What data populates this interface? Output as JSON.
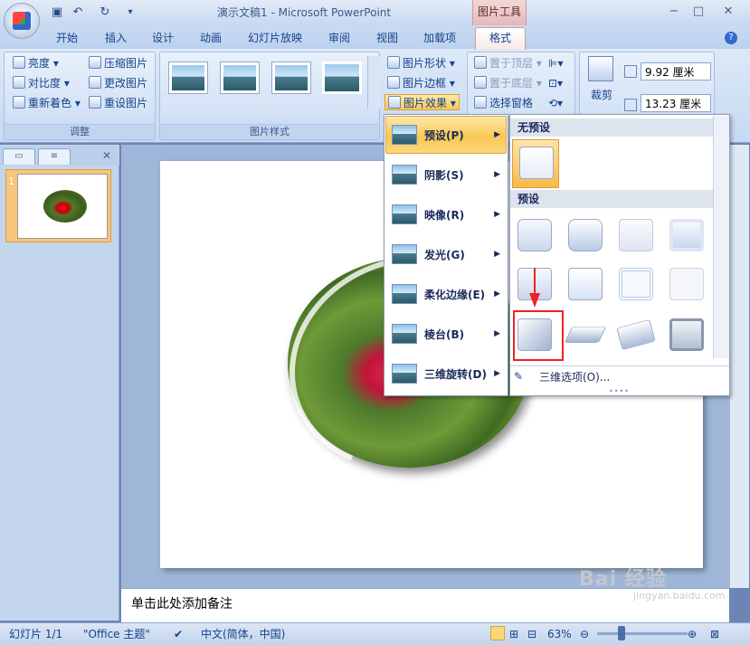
{
  "window": {
    "title": "演示文稿1 - Microsoft PowerPoint",
    "context_tab": "图片工具"
  },
  "tabs": [
    "开始",
    "插入",
    "设计",
    "动画",
    "幻灯片放映",
    "审阅",
    "视图",
    "加载项",
    "格式"
  ],
  "ribbon": {
    "adjust": {
      "label": "调整",
      "items": [
        "亮度",
        "对比度",
        "重新着色",
        "压缩图片",
        "更改图片",
        "重设图片"
      ]
    },
    "styles": {
      "label": "图片样式"
    },
    "picture_tools": [
      "图片形状",
      "图片边框",
      "图片效果"
    ],
    "arrange": {
      "items": [
        "置于顶层",
        "置于底层",
        "选择窗格"
      ]
    },
    "size": {
      "crop": "裁剪",
      "height": "9.92 厘米",
      "width": "13.23 厘米"
    }
  },
  "effects_menu": {
    "items": [
      "预设(P)",
      "阴影(S)",
      "映像(R)",
      "发光(G)",
      "柔化边缘(E)",
      "棱台(B)",
      "三维旋转(D)"
    ]
  },
  "gallery": {
    "header_none": "无预设",
    "header_presets": "预设",
    "option_3d": "三维选项(O)..."
  },
  "notes": {
    "placeholder": "单击此处添加备注"
  },
  "slide_panel": {
    "slide_number": "1"
  },
  "statusbar": {
    "slide": "幻灯片 1/1",
    "theme": "\"Office 主题\"",
    "language": "中文(简体，中国)",
    "zoom": "63%"
  },
  "watermark": {
    "brand": "Bai 经验",
    "sub": "jingyan.baidu.com"
  }
}
